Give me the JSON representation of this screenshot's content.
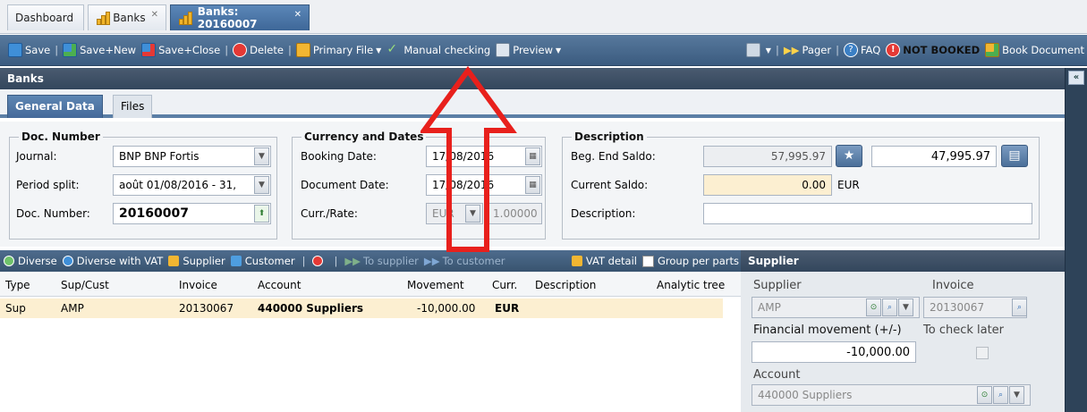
{
  "tabs": [
    {
      "label": "Dashboard"
    },
    {
      "label": "Banks"
    },
    {
      "label": "Banks: 20160007"
    }
  ],
  "toolbar": {
    "save": "Save",
    "save_new": "Save+New",
    "save_close": "Save+Close",
    "delete": "Delete",
    "primary_file": "Primary File",
    "manual_checking": "Manual checking",
    "preview": "Preview",
    "pager": "Pager",
    "faq": "FAQ",
    "status": "NOT BOOKED",
    "book_document": "Book Document"
  },
  "panel": {
    "title": "Banks"
  },
  "subtabs": [
    {
      "label": "General Data"
    },
    {
      "label": "Files"
    }
  ],
  "doc_number": {
    "legend": "Doc. Number",
    "journal_label": "Journal:",
    "journal_value": "BNP BNP Fortis",
    "period_label": "Period split:",
    "period_value": "août 01/08/2016 - 31,",
    "docnum_label": "Doc. Number:",
    "docnum_value": "20160007"
  },
  "currency": {
    "legend": "Currency and Dates",
    "booking_label": "Booking Date:",
    "booking_value": "17/08/2016",
    "document_label": "Document Date:",
    "document_value": "17/08/2016",
    "rate_label": "Curr./Rate:",
    "currency_value": "EUR",
    "rate_value": "1.00000"
  },
  "description": {
    "legend": "Description",
    "saldo_label": "Beg. End Saldo:",
    "beg_saldo": "57,995.97",
    "end_saldo": "47,995.97",
    "current_label": "Current Saldo:",
    "current_value": "0.00",
    "current_currency": "EUR",
    "desc_label": "Description:",
    "desc_value": ""
  },
  "grid_toolbar": {
    "diverse": "Diverse",
    "diverse_vat": "Diverse with VAT",
    "supplier": "Supplier",
    "customer": "Customer",
    "to_supplier": "To supplier",
    "to_customer": "To customer",
    "vat_detail": "VAT detail",
    "group_per_parts": "Group per parts"
  },
  "grid": {
    "columns": [
      "Type",
      "Sup/Cust",
      "Invoice",
      "Account",
      "Movement",
      "Curr.",
      "Description",
      "Analytic tree"
    ],
    "rows": [
      {
        "type": "Sup",
        "supcust": "AMP",
        "invoice": "20130067",
        "account": "440000 Suppliers",
        "movement": "-10,000.00",
        "curr": "EUR",
        "description": "",
        "analytic": ""
      }
    ]
  },
  "supplier_panel": {
    "title": "Supplier",
    "supplier_label": "Supplier",
    "supplier_value": "AMP",
    "invoice_label": "Invoice",
    "invoice_value": "20130067",
    "movement_label": "Financial movement (+/-)",
    "movement_value": "-10,000.00",
    "check_label": "To check later",
    "account_label": "Account",
    "account_value": "440000 Suppliers"
  },
  "colors": {
    "annotation_arrow": "#e8201c",
    "toolbar_bg": "#4a6a8f",
    "highlight_row": "#fcefd1"
  }
}
